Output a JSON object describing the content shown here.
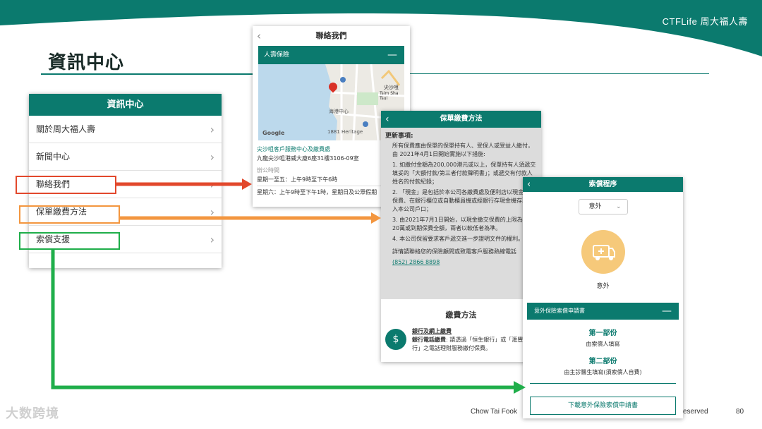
{
  "brand": {
    "logo_text": "CTFLife 周大福人壽"
  },
  "page": {
    "title": "資訊中心"
  },
  "menu_panel": {
    "header": "資訊中心",
    "items": [
      {
        "label": "關於周大福人壽"
      },
      {
        "label": "新聞中心"
      },
      {
        "label": "聯絡我們"
      },
      {
        "label": "保單繳費方法"
      },
      {
        "label": "索償支援"
      }
    ],
    "chevron": "›"
  },
  "contact_panel": {
    "nav_title": "聯絡我們",
    "back": "‹",
    "section_bar": "人壽保險",
    "collapse": "—",
    "map": {
      "label_district": "尖沙咀",
      "label_district_en": "Tsim Sha Tsui",
      "label_harbour": "海港中心",
      "label_heritage": "1881 Heritage",
      "label_google": "Google",
      "label_road": "九龍公園徑"
    },
    "office_name": "尖沙咀客戶服務中心及繳費處",
    "office_address": "九龍尖沙咀港威大廈6座31樓3106-09室",
    "hours_label": "辦公時間",
    "hours_weekday": "星期一至五：上午9時至下午6時",
    "hours_saturday": "星期六：上午9時至下午1時，星期日及公眾假期"
  },
  "payment_panel": {
    "nav_title": "保單繳費方法",
    "back": "‹",
    "notice_title": "更新事項:",
    "notice_intro": "所有保費應由保單的保單持有人、受保人或受益人繳付，由 2021年4月1日開始實施以下措施:",
    "notice_items": [
      "1. 如繳付金額為200,000港元或以上，保單持有人須遞交填妥的「大額付款/第三者付款聲明書」；或遞交有付款人姓名的付款紀錄；",
      "2. 「現金」是包括於本公司各繳費處及便利店以現金繳付保費、在銀行櫃位或自動櫃員機或經銀行存現金機存現金入本公司戶口；",
      "3. 由2021年7月1日開始，以現金繳交保費的上限為港元20萬或到期保費全額，兩者以較低者為準。",
      "4. 本公司保留要求客戶遞交進一步證明文件的權利。"
    ],
    "notice_contact": "詳情請聯絡您的保險顧問或致電客戶服務熱線電話",
    "hotline": "(852) 2866 8898",
    "methods_title": "繳費方法",
    "method_title": "銀行及網上繳費",
    "method_desc_bold": "銀行電話繳費",
    "method_desc": ": 請透過「恒生銀行」或「滙豐銀行」之電話理財服務繳付保費。"
  },
  "claim_panel": {
    "nav_title": "索償程序",
    "back": "‹",
    "select_value": "意外",
    "select_caret": "⌄",
    "icon_caption": "意外",
    "form_bar": "意外保險索償申請書",
    "collapse": "—",
    "part1_title": "第一部份",
    "part1_sub": "由索償人填寫",
    "part2_title": "第二部份",
    "part2_sub": "由主診醫生填寫(須索償人自費)",
    "download_button": "下載意外保險索償申請書"
  },
  "footer": {
    "left": "Chow Tai Fook",
    "right": "eserved",
    "page_number": "80",
    "watermark": "大数跨境"
  },
  "colors": {
    "brand_teal": "#0b7a6e",
    "arrow_red": "#e2482c",
    "arrow_orange": "#f3963f",
    "arrow_green": "#1fae4a"
  }
}
